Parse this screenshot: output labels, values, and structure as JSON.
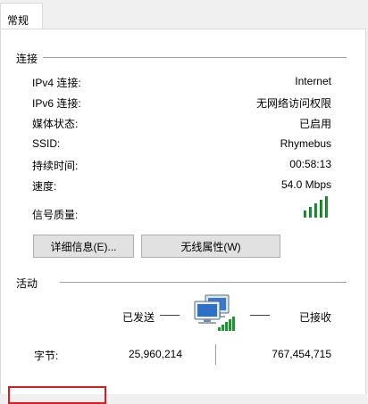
{
  "tabs": [
    {
      "label": "常规",
      "selected": true
    }
  ],
  "connection": {
    "title": "连接",
    "rows": [
      {
        "label": "IPv4 连接:",
        "value": "Internet"
      },
      {
        "label": "IPv6 连接:",
        "value": "无网络访问权限"
      },
      {
        "label": "媒体状态:",
        "value": "已启用"
      },
      {
        "label": "SSID:",
        "value": "Rhymebus"
      },
      {
        "label": "持续时间:",
        "value": "00:58:13"
      },
      {
        "label": "速度:",
        "value": "54.0 Mbps"
      }
    ],
    "signal_label": "信号质量:",
    "signal_level": 5,
    "signal_max": 5
  },
  "buttons": {
    "details": "详细信息(E)...",
    "wireless_props": "无线属性(W)"
  },
  "activity": {
    "title": "活动",
    "sent_label": "已发送",
    "received_label": "已接收",
    "bytes_label": "字节:",
    "bytes_sent": "25,960,214",
    "bytes_received": "767,454,715"
  },
  "colors": {
    "signal": "#2e8b3c",
    "highlight_box": "#e0191b"
  },
  "icons": {
    "network": "network-computers-icon",
    "signal": "signal-strength-icon"
  }
}
